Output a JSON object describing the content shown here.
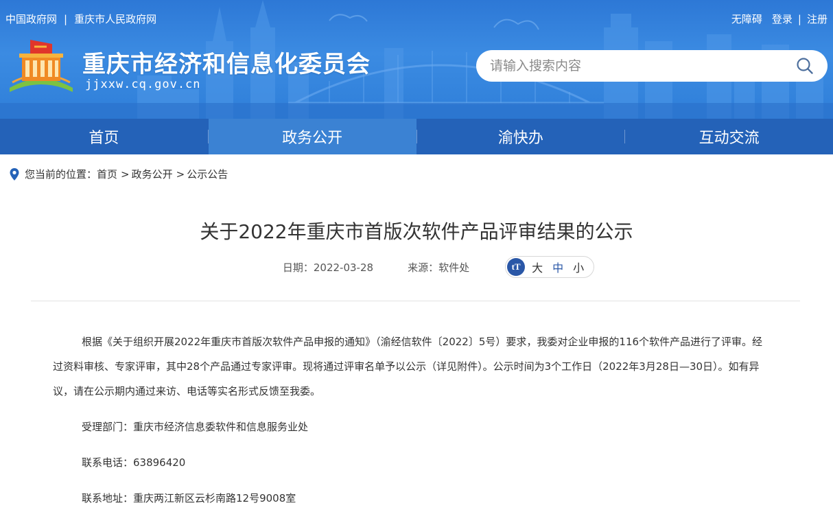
{
  "top_links": {
    "gov_cn": "中国政府网",
    "separator": "|",
    "cq_gov": "重庆市人民政府网"
  },
  "user_links": {
    "accessibility": "无障碍",
    "login": "登录",
    "separator": "|",
    "register": "注册"
  },
  "site": {
    "title": "重庆市经济和信息化委员会",
    "domain": "jjxxw.cq.gov.cn"
  },
  "search": {
    "placeholder": "请输入搜索内容",
    "icon": "search-icon"
  },
  "nav": {
    "items": [
      {
        "label": "首页"
      },
      {
        "label": "政务公开",
        "active": true
      },
      {
        "label": "渝快办"
      },
      {
        "label": "互动交流"
      }
    ]
  },
  "breadcrumb": {
    "prefix": "您当前的位置：",
    "items": [
      "首页",
      "政务公开",
      "公示公告"
    ],
    "arrow": ">"
  },
  "article": {
    "title": "关于2022年重庆市首版次软件产品评审结果的公示",
    "date": "日期：2022-03-28",
    "source": "来源：软件处",
    "font_sizes": {
      "large": "大",
      "medium": "中",
      "small": "小"
    },
    "paragraphs": [
      "根据《关于组织开展2022年重庆市首版次软件产品申报的通知》（渝经信软件〔2022〕5号）要求，我委对企业申报的116个软件产品进行了评审。经过资料审核、专家评审，其中28个产品通过专家评审。现将通过评审名单予以公示（详见附件）。公示时间为3个工作日（2022年3月28日—30日）。如有异议，请在公示期内通过来访、电话等实名形式反馈至我委。",
      "受理部门：重庆市经济信息委软件和信息服务业处",
      "联系电话：63896420",
      "联系地址：重庆两江新区云杉南路12号9008室"
    ]
  },
  "colors": {
    "header_blue": "#2d78d6",
    "nav_blue": "#2462b8",
    "nav_active": "#3b82d3",
    "font_ctrl_blue": "#2a57a7"
  }
}
